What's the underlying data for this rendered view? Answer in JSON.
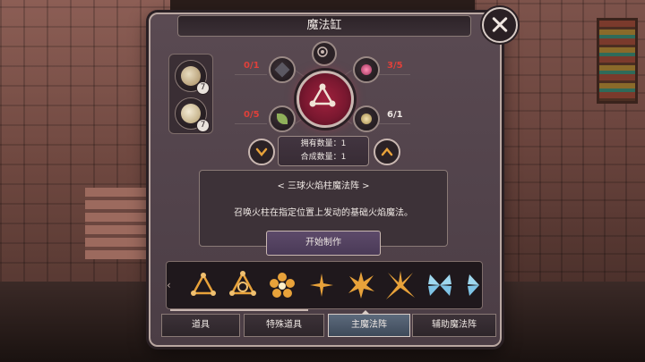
{
  "window": {
    "title": "魔法缸"
  },
  "inventory_slots": [
    {
      "count": "7",
      "icon": "book-quill-icon"
    },
    {
      "count": "7",
      "icon": "pouch-icon"
    }
  ],
  "materials": [
    {
      "count": "0/1",
      "status_color": "#e0403a",
      "icon": "dark-shard-icon"
    },
    {
      "count": "3/5",
      "status_color": "#e0403a",
      "icon": "pink-crystal-icon"
    },
    {
      "count": "0/5",
      "status_color": "#e0403a",
      "icon": "green-leaf-icon"
    },
    {
      "count": "6/1",
      "status_color": "#efe8e4",
      "icon": "golden-orb-icon"
    }
  ],
  "quantity": {
    "owned_label": "拥有数量：1",
    "craft_label": "合成数量：1"
  },
  "description": {
    "name": "< 三球火焰柱魔法阵 >",
    "text": "召唤火柱在指定位置上发动的基础火焰魔法。"
  },
  "craft_button": "开始制作",
  "recipes": [
    "triangle-rune-icon",
    "triangle-ring-rune-icon",
    "flower-rune-icon",
    "four-point-star-rune-icon",
    "burst-star-rune-icon",
    "spike-star-rune-icon",
    "ice-crystal-rune-icon",
    "partial-ice-rune-icon"
  ],
  "tabs": [
    {
      "label": "道具",
      "active": false
    },
    {
      "label": "特殊道具",
      "active": false
    },
    {
      "label": "主魔法阵",
      "active": true
    },
    {
      "label": "辅助魔法阵",
      "active": false
    }
  ],
  "colors": {
    "accent_gold": "#e8a23a",
    "missing_red": "#e0403a",
    "active_tab": "#5c6a7c"
  }
}
